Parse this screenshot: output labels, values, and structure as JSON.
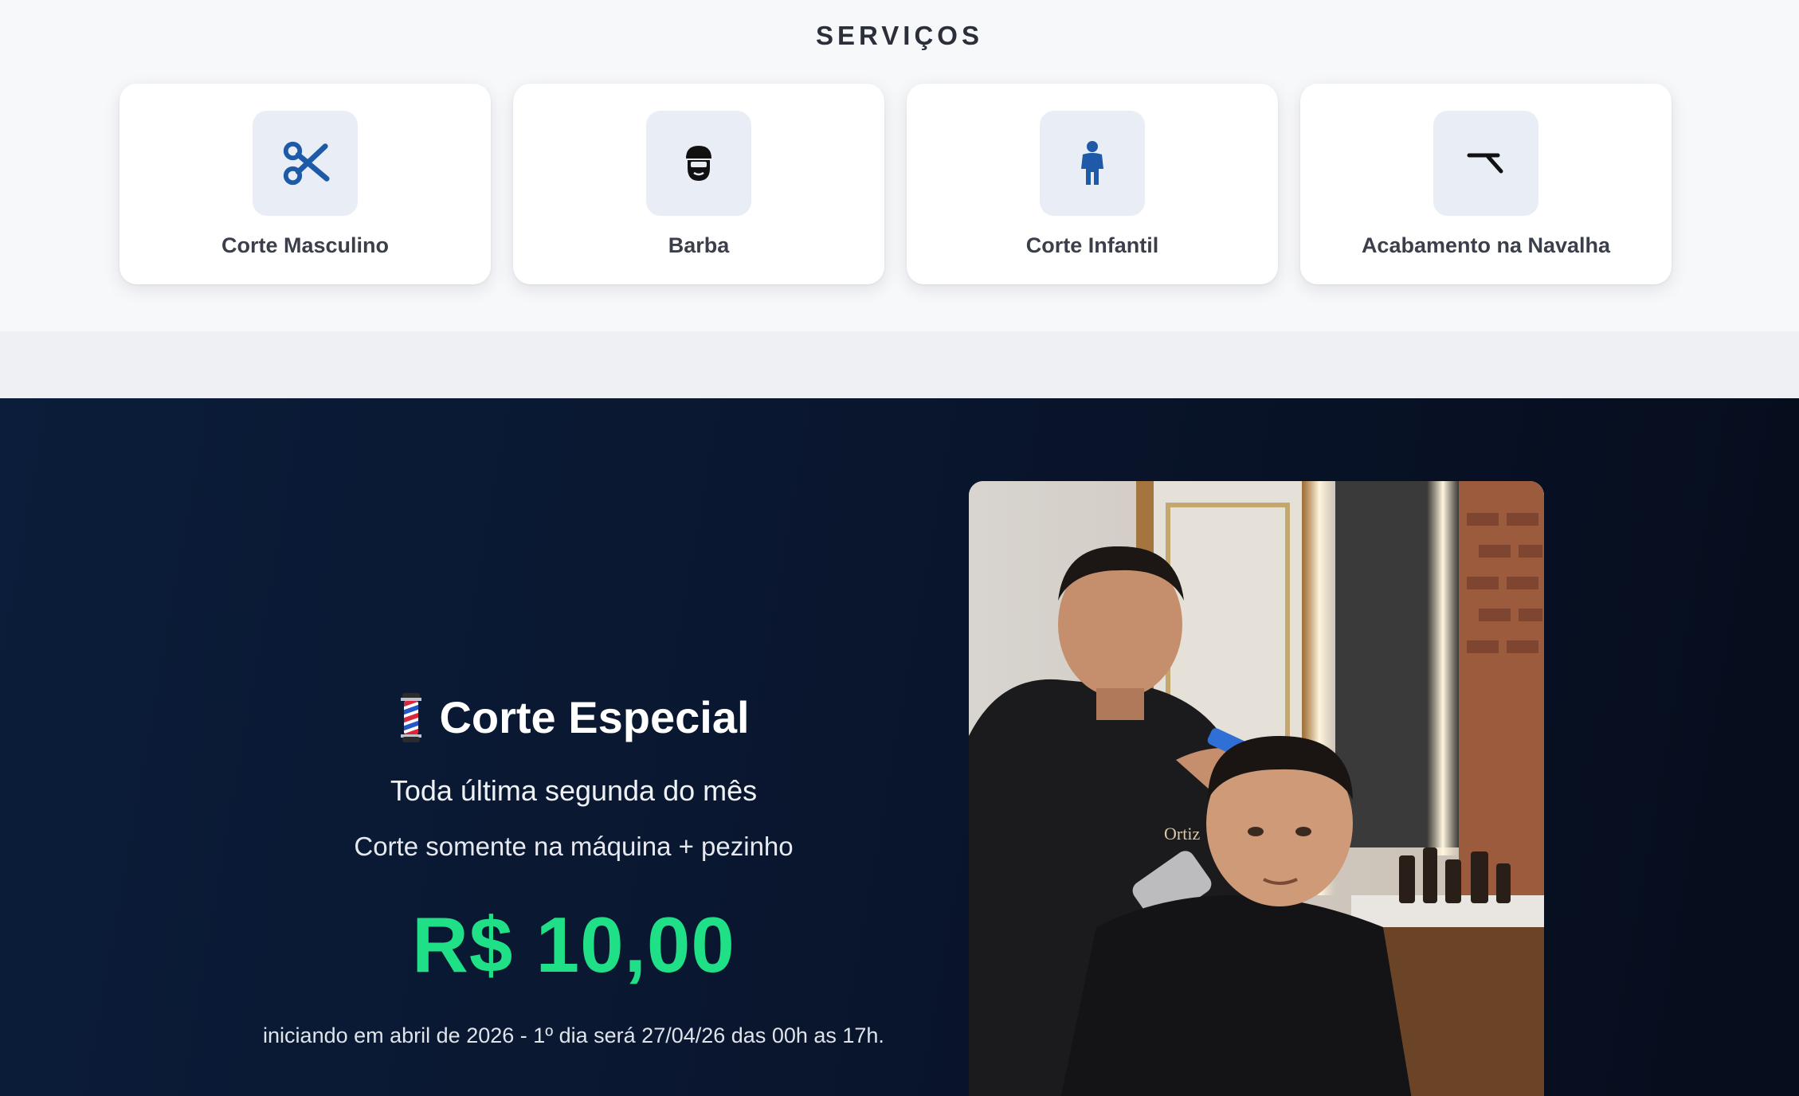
{
  "services": {
    "title": "SERVIÇOS",
    "items": [
      {
        "label": "Corte Masculino",
        "icon": "scissors-icon"
      },
      {
        "label": "Barba",
        "icon": "bearded-face-icon"
      },
      {
        "label": "Corte Infantil",
        "icon": "child-icon"
      },
      {
        "label": "Acabamento na Navalha",
        "icon": "razor-icon"
      }
    ]
  },
  "promo": {
    "icon": "barber-pole-icon",
    "title": "Corte Especial",
    "subtitle": "Toda última segunda do mês",
    "description": "Corte somente na máquina + pezinho",
    "price": "R$ 10,00",
    "note": "iniciando em abril de 2026 - 1º dia será 27/04/26 das 00h as 17h.",
    "photo_logo": "Ortiz"
  },
  "colors": {
    "accent_blue": "#1e5aa8",
    "price_green": "#1fe087",
    "promo_bg": "#0a1730"
  }
}
